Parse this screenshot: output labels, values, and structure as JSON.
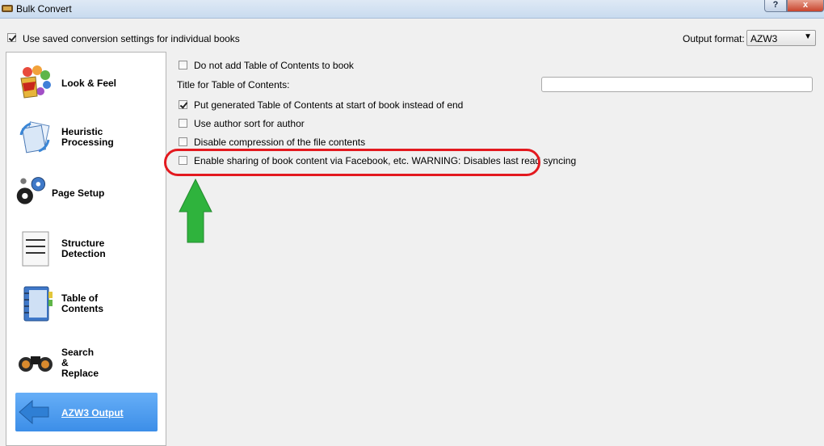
{
  "window": {
    "title": "Bulk Convert",
    "help_label": "?",
    "close_label": "x"
  },
  "top": {
    "use_saved_label": "Use saved conversion settings for individual books",
    "use_saved_checked": true,
    "output_format_label": "Output format:",
    "output_format_value": "AZW3"
  },
  "sidebar": {
    "items": [
      {
        "label": "Look & Feel",
        "icon": "paint-bucket-icon"
      },
      {
        "label": "Heuristic Processing",
        "icon": "heuristic-documents-icon"
      },
      {
        "label": "Page Setup",
        "icon": "gears-icon"
      },
      {
        "label": "Structure Detection",
        "icon": "document-lines-icon"
      },
      {
        "label": "Table of Contents",
        "icon": "notebook-icon"
      },
      {
        "label": "Search & Replace",
        "icon": "binoculars-icon"
      },
      {
        "label": "AZW3 Output",
        "icon": "back-arrow-icon",
        "selected": true
      }
    ]
  },
  "options": {
    "no_toc_label": "Do not add Table of Contents to book",
    "no_toc_checked": false,
    "toc_title_label": "Title for Table of Contents:",
    "toc_title_value": "",
    "toc_at_start_label": "Put generated Table of Contents at start of book instead of end",
    "toc_at_start_checked": true,
    "author_sort_label": "Use author sort for author",
    "author_sort_checked": false,
    "disable_compression_label": "Disable compression of the file contents",
    "disable_compression_checked": false,
    "share_label": "Enable sharing of book content via Facebook, etc. WARNING: Disables last read syncing",
    "share_checked": false
  },
  "colors": {
    "highlight": "#e3191f",
    "arrow": "#2fb33d",
    "selected_item": "#4a9af0"
  }
}
